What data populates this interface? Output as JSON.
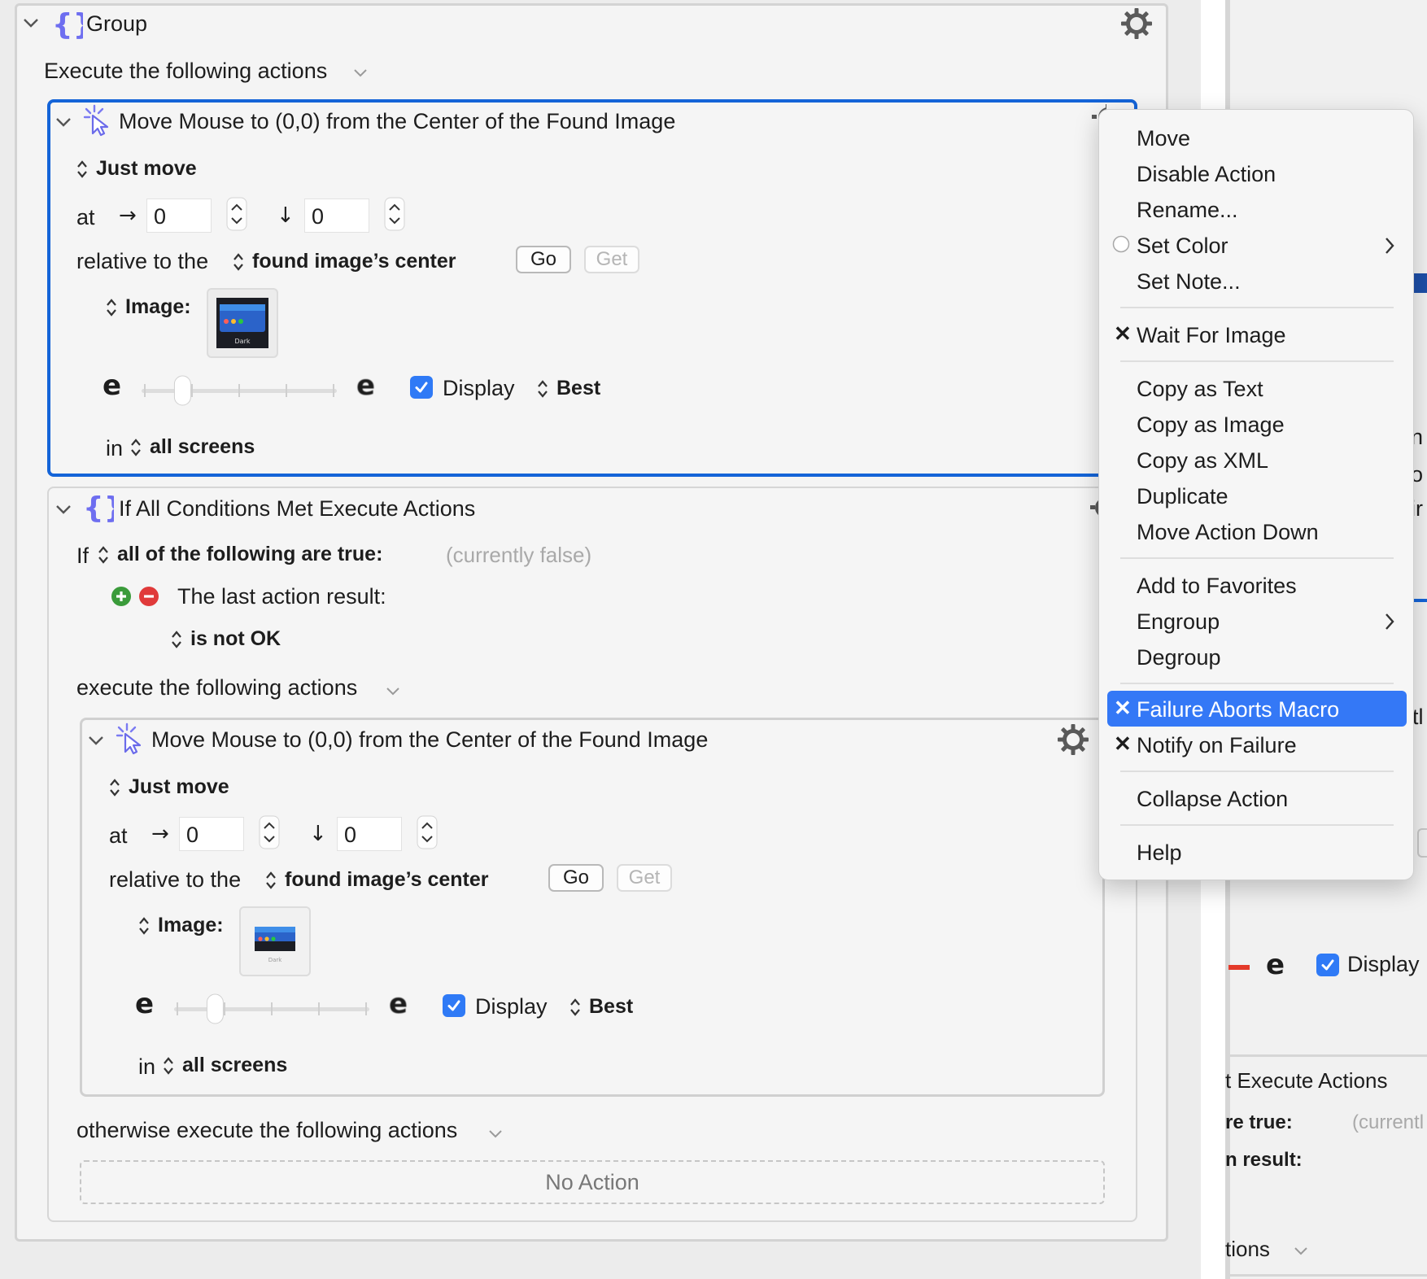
{
  "group": {
    "title": "Group",
    "execute_label": "Execute the following actions"
  },
  "action1": {
    "title": "Move Mouse to (0,0) from the Center of the Found Image",
    "mode": "Just move",
    "at_label": "at",
    "x_value": "0",
    "y_value": "0",
    "relative_label": "relative to the",
    "relative_value": "found image’s center",
    "go_label": "Go",
    "get_label": "Get",
    "image_label": "Image:",
    "thumb_caption": "Dark",
    "display_label": "Display",
    "display_checked": true,
    "best_label": "Best",
    "in_label": "in",
    "screens_label": "all screens",
    "slider_value": 0.2
  },
  "if_action": {
    "title": "If All Conditions Met Execute Actions",
    "if_label": "If",
    "condition_mode": "all of the following are true:",
    "status": "(currently false)",
    "condition_text": "The last action result:",
    "condition_value": "is not OK",
    "execute_label": "execute the following actions",
    "otherwise_label": "otherwise execute the following actions",
    "no_action": "No Action"
  },
  "action2": {
    "title": "Move Mouse to (0,0) from the Center of the Found Image",
    "mode": "Just move",
    "at_label": "at",
    "x_value": "0",
    "y_value": "0",
    "relative_label": "relative to the",
    "relative_value": "found image’s center",
    "go_label": "Go",
    "get_label": "Get",
    "image_label": "Image:",
    "thumb_caption": "Dark",
    "display_label": "Display",
    "display_checked": true,
    "best_label": "Best",
    "in_label": "in",
    "screens_label": "all screens",
    "slider_value": 0.2
  },
  "menu": {
    "items": [
      {
        "label": "Move"
      },
      {
        "label": "Disable Action"
      },
      {
        "label": "Rename..."
      },
      {
        "label": "Set Color",
        "submenu": true,
        "radio": true
      },
      {
        "label": "Set Note..."
      },
      {
        "label": "Wait For Image",
        "checked": true
      },
      {
        "label": "Copy as Text"
      },
      {
        "label": "Copy as Image"
      },
      {
        "label": "Copy as XML"
      },
      {
        "label": "Duplicate"
      },
      {
        "label": "Move Action Down"
      },
      {
        "label": "Add to Favorites"
      },
      {
        "label": "Engroup",
        "submenu": true
      },
      {
        "label": "Degroup"
      },
      {
        "label": "Failure Aborts Macro",
        "checked": true,
        "highlighted": true
      },
      {
        "label": "Notify on Failure",
        "checked": true
      },
      {
        "label": "Collapse Action"
      },
      {
        "label": "Help"
      }
    ],
    "check_glyph": "✕",
    "highlight_color": "#3478f6"
  },
  "background_right": {
    "display_label": "Display",
    "e_glyph": "e",
    "execute_fragment": "t Execute Actions",
    "true_fragment": "re true:",
    "currently_fragment": "(currentl",
    "result_fragment": "n result:",
    "actions_fragment": "tions",
    "edge_letters": [
      "n",
      "o",
      "ir",
      "tl"
    ]
  },
  "colors": {
    "accent": "#1464d8",
    "checkbox": "#2f7af6",
    "add_green": "#3a9b3a",
    "remove_red": "#e03a3a",
    "braces": "#6e6ef0"
  }
}
